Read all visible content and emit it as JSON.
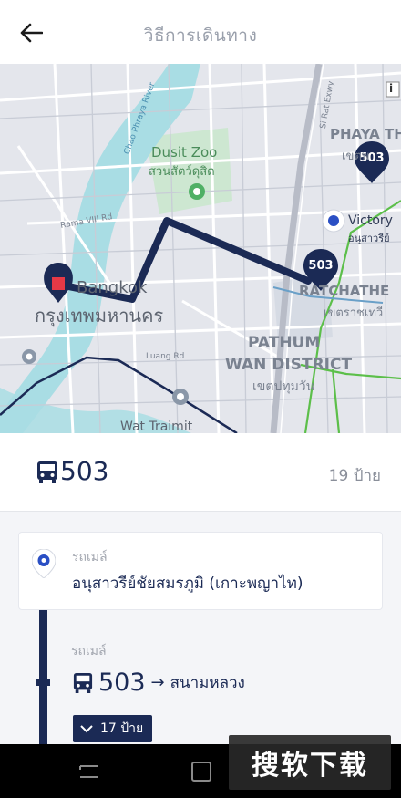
{
  "header": {
    "title": "วิธีการเดินทาง",
    "back_icon": "back-arrow-icon"
  },
  "map": {
    "labels": {
      "dusit_zoo_en": "Dusit Zoo",
      "dusit_zoo_th": "สวนสัตว์ดุสิต",
      "bangkok_en": "Bangkok",
      "bangkok_th": "กรุงเทพมหานคร",
      "phaya_thai_en": "PHAYA TH",
      "phaya_thai_th": "เขตพ",
      "victory_en": "Victory",
      "victory_th": "อนุสาวรีย์",
      "ratchathewi_en": "RATCHATHE",
      "ratchathewi_th": "เขตราชเทวี",
      "pathum_wan_en_1": "PATHUM",
      "pathum_wan_en_2": "WAN DISTRICT",
      "pathum_wan_th": "เขตปทุมวัน",
      "wat_traimit": "Wat Traimit",
      "luang_rd": "Luang Rd",
      "rama_viii_rd": "Rama VIII Rd",
      "chao_phraya": "Chao Phraya River",
      "si_rat_exwy": "Si Rat Exwy"
    },
    "bus_markers": [
      {
        "label": "503"
      },
      {
        "label": "503"
      }
    ],
    "info_icon": "i"
  },
  "route": {
    "bus_number": "503",
    "stop_count": "19 ป้าย",
    "bus_icon": "bus-icon"
  },
  "itinerary": {
    "origin": {
      "type_label": "รถเมล์",
      "name": "อนุสาวรีย์ชัยสมรภูมิ (เกาะพญาไท)"
    },
    "segment": {
      "type_label": "รถเมล์",
      "bus_number": "503",
      "arrow": "→",
      "destination": "สนามหลวง",
      "stops_toggle": "17 ป้าย"
    }
  },
  "watermark": {
    "text": "搜软下载"
  },
  "colors": {
    "navy": "#1b2a55",
    "map_bg": "#e4e6ec",
    "water": "#a9dde4",
    "park": "#c9e6cd",
    "route_green": "#5cbf4a",
    "accent_blue": "#2a4fc4"
  }
}
